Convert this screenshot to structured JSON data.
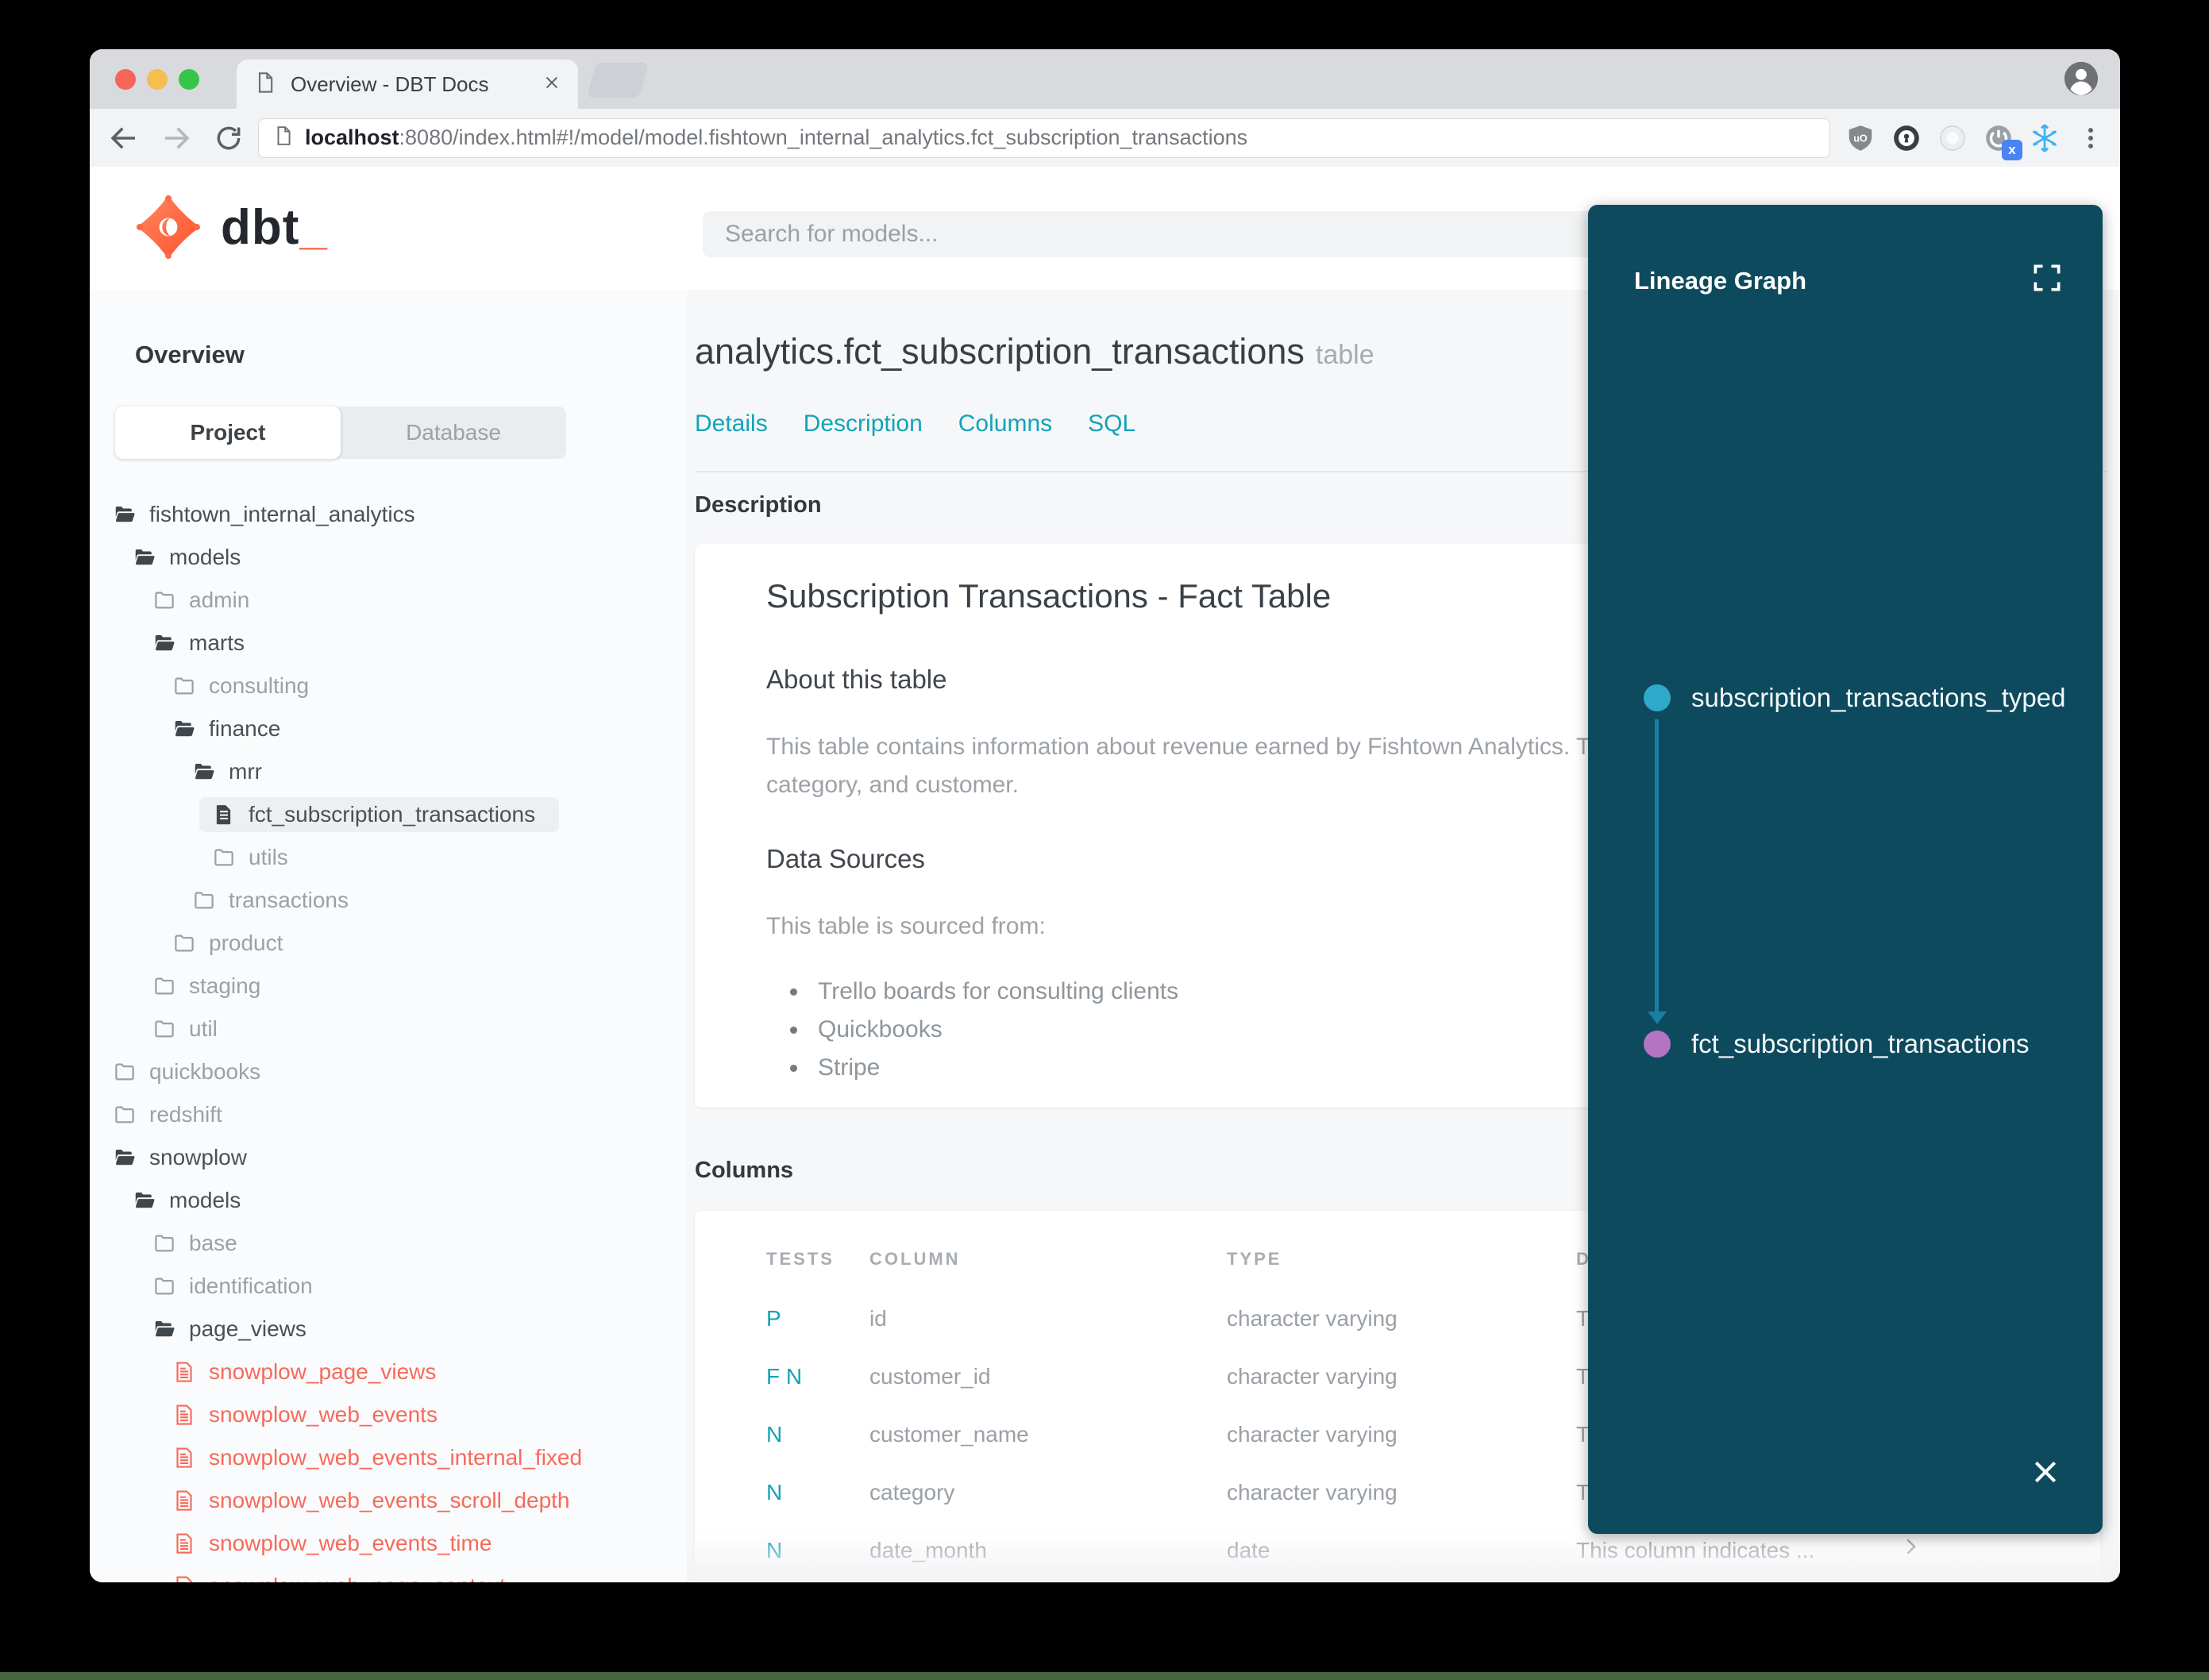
{
  "browser": {
    "tab_title": "Overview - DBT Docs",
    "url_host": "localhost",
    "url_rest": ":8080/index.html#!/model/model.fishtown_internal_analytics.fct_subscription_transactions"
  },
  "header": {
    "logo_text": "dbt",
    "logo_cursor": "_",
    "search_placeholder": "Search for models..."
  },
  "sidebar": {
    "section_title": "Overview",
    "tabs": [
      {
        "label": "Project",
        "active": true
      },
      {
        "label": "Database",
        "active": false
      }
    ],
    "tree": [
      {
        "label": "fishtown_internal_analytics",
        "level": 0,
        "icon": "folder-open",
        "tone": "dark"
      },
      {
        "label": "models",
        "level": 1,
        "icon": "folder-open",
        "tone": "dark"
      },
      {
        "label": "admin",
        "level": 2,
        "icon": "folder-closed",
        "tone": "muted"
      },
      {
        "label": "marts",
        "level": 2,
        "icon": "folder-open",
        "tone": "dark"
      },
      {
        "label": "consulting",
        "level": 3,
        "icon": "folder-closed",
        "tone": "muted"
      },
      {
        "label": "finance",
        "level": 3,
        "icon": "folder-open",
        "tone": "dark"
      },
      {
        "label": "mrr",
        "level": 4,
        "icon": "folder-open",
        "tone": "dark"
      },
      {
        "label": "fct_subscription_transactions",
        "level": 5,
        "icon": "file",
        "tone": "dark",
        "selected": true
      },
      {
        "label": "utils",
        "level": 5,
        "icon": "folder-closed",
        "tone": "muted"
      },
      {
        "label": "transactions",
        "level": 4,
        "icon": "folder-closed",
        "tone": "muted"
      },
      {
        "label": "product",
        "level": 3,
        "icon": "folder-closed",
        "tone": "muted"
      },
      {
        "label": "staging",
        "level": 2,
        "icon": "folder-closed",
        "tone": "muted"
      },
      {
        "label": "util",
        "level": 2,
        "icon": "folder-closed",
        "tone": "muted"
      },
      {
        "label": "quickbooks",
        "level": 0,
        "icon": "folder-closed",
        "tone": "muted"
      },
      {
        "label": "redshift",
        "level": 0,
        "icon": "folder-closed",
        "tone": "muted"
      },
      {
        "label": "snowplow",
        "level": 0,
        "icon": "folder-open",
        "tone": "dark"
      },
      {
        "label": "models",
        "level": 1,
        "icon": "folder-open",
        "tone": "dark"
      },
      {
        "label": "base",
        "level": 2,
        "icon": "folder-closed",
        "tone": "muted"
      },
      {
        "label": "identification",
        "level": 2,
        "icon": "folder-closed",
        "tone": "muted"
      },
      {
        "label": "page_views",
        "level": 2,
        "icon": "folder-open",
        "tone": "dark"
      },
      {
        "label": "snowplow_page_views",
        "level": 3,
        "icon": "file-red",
        "tone": "red"
      },
      {
        "label": "snowplow_web_events",
        "level": 3,
        "icon": "file-red",
        "tone": "red"
      },
      {
        "label": "snowplow_web_events_internal_fixed",
        "level": 3,
        "icon": "file-red",
        "tone": "red"
      },
      {
        "label": "snowplow_web_events_scroll_depth",
        "level": 3,
        "icon": "file-red",
        "tone": "red"
      },
      {
        "label": "snowplow_web_events_time",
        "level": 3,
        "icon": "file-red",
        "tone": "red"
      },
      {
        "label": "snowplow_web_page_context",
        "level": 3,
        "icon": "file-red",
        "tone": "red"
      }
    ]
  },
  "main": {
    "title": "analytics.fct_subscription_transactions",
    "title_suffix": "table",
    "nav": [
      "Details",
      "Description",
      "Columns",
      "SQL"
    ],
    "description_section": {
      "label": "Description",
      "heading": "Subscription Transactions - Fact Table",
      "about_heading": "About this table",
      "about_text": "This table contains information about revenue earned by Fishtown Analytics. Transactions are grouped by month, category, and customer.",
      "sources_heading": "Data Sources",
      "sources_intro": "This table is sourced from:",
      "sources": [
        "Trello boards for consulting clients",
        "Quickbooks",
        "Stripe"
      ]
    },
    "columns_section": {
      "label": "Columns",
      "table_headers": [
        "TESTS",
        "COLUMN",
        "TYPE",
        "DESCRIPTION"
      ],
      "rows": [
        {
          "tests": "P",
          "column": "id",
          "type": "character varying",
          "description": "T"
        },
        {
          "tests": "F N",
          "column": "customer_id",
          "type": "character varying",
          "description": "T"
        },
        {
          "tests": "N",
          "column": "customer_name",
          "type": "character varying",
          "description": "T"
        },
        {
          "tests": "N",
          "column": "category",
          "type": "character varying",
          "description": "T"
        },
        {
          "tests": "N",
          "column": "date_month",
          "type": "date",
          "description": "This column indicates ...",
          "chevron": true
        }
      ]
    }
  },
  "lineage": {
    "title": "Lineage Graph",
    "nodes": [
      {
        "label": "subscription_transactions_typed",
        "color": "#2fa9c9"
      },
      {
        "label": "fct_subscription_transactions",
        "color": "#b573c3"
      }
    ]
  },
  "colors": {
    "accent_teal": "#14a3b8",
    "model_red": "#f8695a",
    "lineage_bg": "#0d4a5e",
    "lineage_edge": "#1a7fa4",
    "brand_orange": "#ff694b"
  }
}
